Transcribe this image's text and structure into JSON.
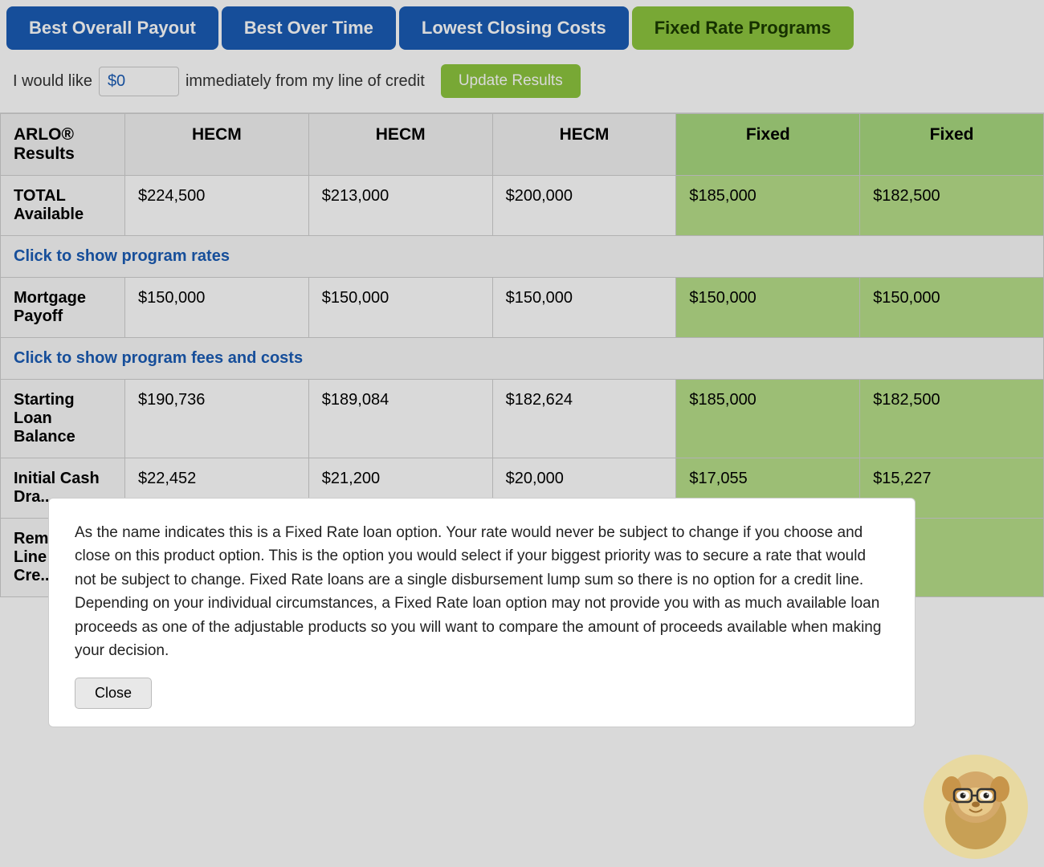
{
  "tabs": [
    {
      "label": "Best Overall Payout",
      "style": "blue"
    },
    {
      "label": "Best Over Time",
      "style": "blue"
    },
    {
      "label": "Lowest Closing Costs",
      "style": "blue"
    },
    {
      "label": "Fixed Rate Programs",
      "style": "green"
    }
  ],
  "input_row": {
    "prefix": "I would like",
    "value": "$0",
    "suffix": "immediately from my line of credit",
    "button_label": "Update Results"
  },
  "table": {
    "headers": [
      {
        "label": "ARLO®\nResults",
        "green": false
      },
      {
        "label": "HECM",
        "green": false
      },
      {
        "label": "HECM",
        "green": false
      },
      {
        "label": "HECM",
        "green": false
      },
      {
        "label": "Fixed",
        "green": true
      },
      {
        "label": "Fixed",
        "green": true
      }
    ],
    "rows": [
      {
        "type": "data",
        "cells": [
          "TOTAL\nAvailable",
          "$224,500",
          "$213,000",
          "$200,000",
          "$185,000",
          "$182,500"
        ],
        "green_cols": [
          4,
          5
        ]
      },
      {
        "type": "click",
        "label": "Click to show program rates",
        "colspan": 6
      },
      {
        "type": "data",
        "cells": [
          "Mortgage\nPayoff",
          "$150,000",
          "$150,000",
          "$150,000",
          "$150,000",
          "$150,000"
        ],
        "green_cols": [
          4,
          5
        ]
      },
      {
        "type": "click",
        "label": "Click to show program fees and costs",
        "colspan": 6
      },
      {
        "type": "data",
        "cells": [
          "Starting\nLoan\nBalance",
          "$190,736",
          "$189,084",
          "$182,624",
          "$185,000",
          "$182,500"
        ],
        "green_cols": [
          4,
          5
        ]
      },
      {
        "type": "partial",
        "cells": [
          "Initial Cash\nDra...",
          "$22,452",
          "$21,200",
          "$20,000",
          "$17,055",
          "$15,227"
        ],
        "green_cols": [
          4,
          5
        ]
      },
      {
        "type": "partial",
        "cells": [
          "Rem...\nLine\nCre...",
          "",
          "",
          "",
          "",
          ""
        ],
        "green_cols": [
          4,
          5
        ]
      }
    ]
  },
  "popup": {
    "text": "As the name indicates this is a Fixed Rate loan option. Your rate would never be subject to change if you choose and close on this product option. This is the option you would select if your biggest priority was to secure a rate that would not be subject to change. Fixed Rate loans are a single disbursement lump sum so there is no option for a credit line. Depending on your individual circumstances, a Fixed Rate loan option may not provide you with as much available loan proceeds as one of the adjustable products so you will want to compare the amount of proceeds available when making your decision.",
    "close_label": "Close"
  }
}
